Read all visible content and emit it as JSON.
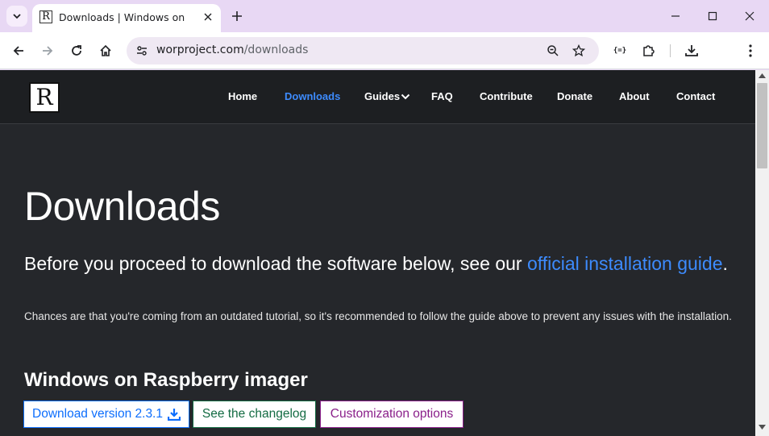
{
  "browser": {
    "tab": {
      "title": "Downloads | Windows on R",
      "favicon_letter": "R"
    },
    "address": {
      "domain": "worproject.com",
      "path": "/downloads"
    },
    "extensions_label": "{=}"
  },
  "site": {
    "logo_letter": "R",
    "nav": [
      {
        "label": "Home",
        "active": false
      },
      {
        "label": "Downloads",
        "active": true
      },
      {
        "label": "Guides",
        "active": false,
        "dropdown": true
      },
      {
        "label": "FAQ",
        "active": false
      },
      {
        "label": "Contribute",
        "active": false
      },
      {
        "label": "Donate",
        "active": false
      },
      {
        "label": "About",
        "active": false
      },
      {
        "label": "Contact",
        "active": false
      }
    ]
  },
  "page": {
    "title": "Downloads",
    "lead_prefix": "Before you proceed to download the software below, see our ",
    "lead_link": "official installation guide",
    "lead_suffix": ".",
    "paragraph": "Chances are that you're coming from an outdated tutorial, so it's recommended to follow the guide above to prevent any issues with the installation.",
    "section_title": "Windows on Raspberry imager",
    "buttons": {
      "download": "Download version 2.3.1",
      "changelog": "See the changelog",
      "customization": "Customization options"
    }
  },
  "colors": {
    "accent": "#3d8bfd",
    "page_bg": "#25272b",
    "nav_bg": "#1d1f22",
    "btn_download": "#0d6efd",
    "btn_changelog": "#146c43",
    "btn_customization": "#8a1f8a"
  }
}
